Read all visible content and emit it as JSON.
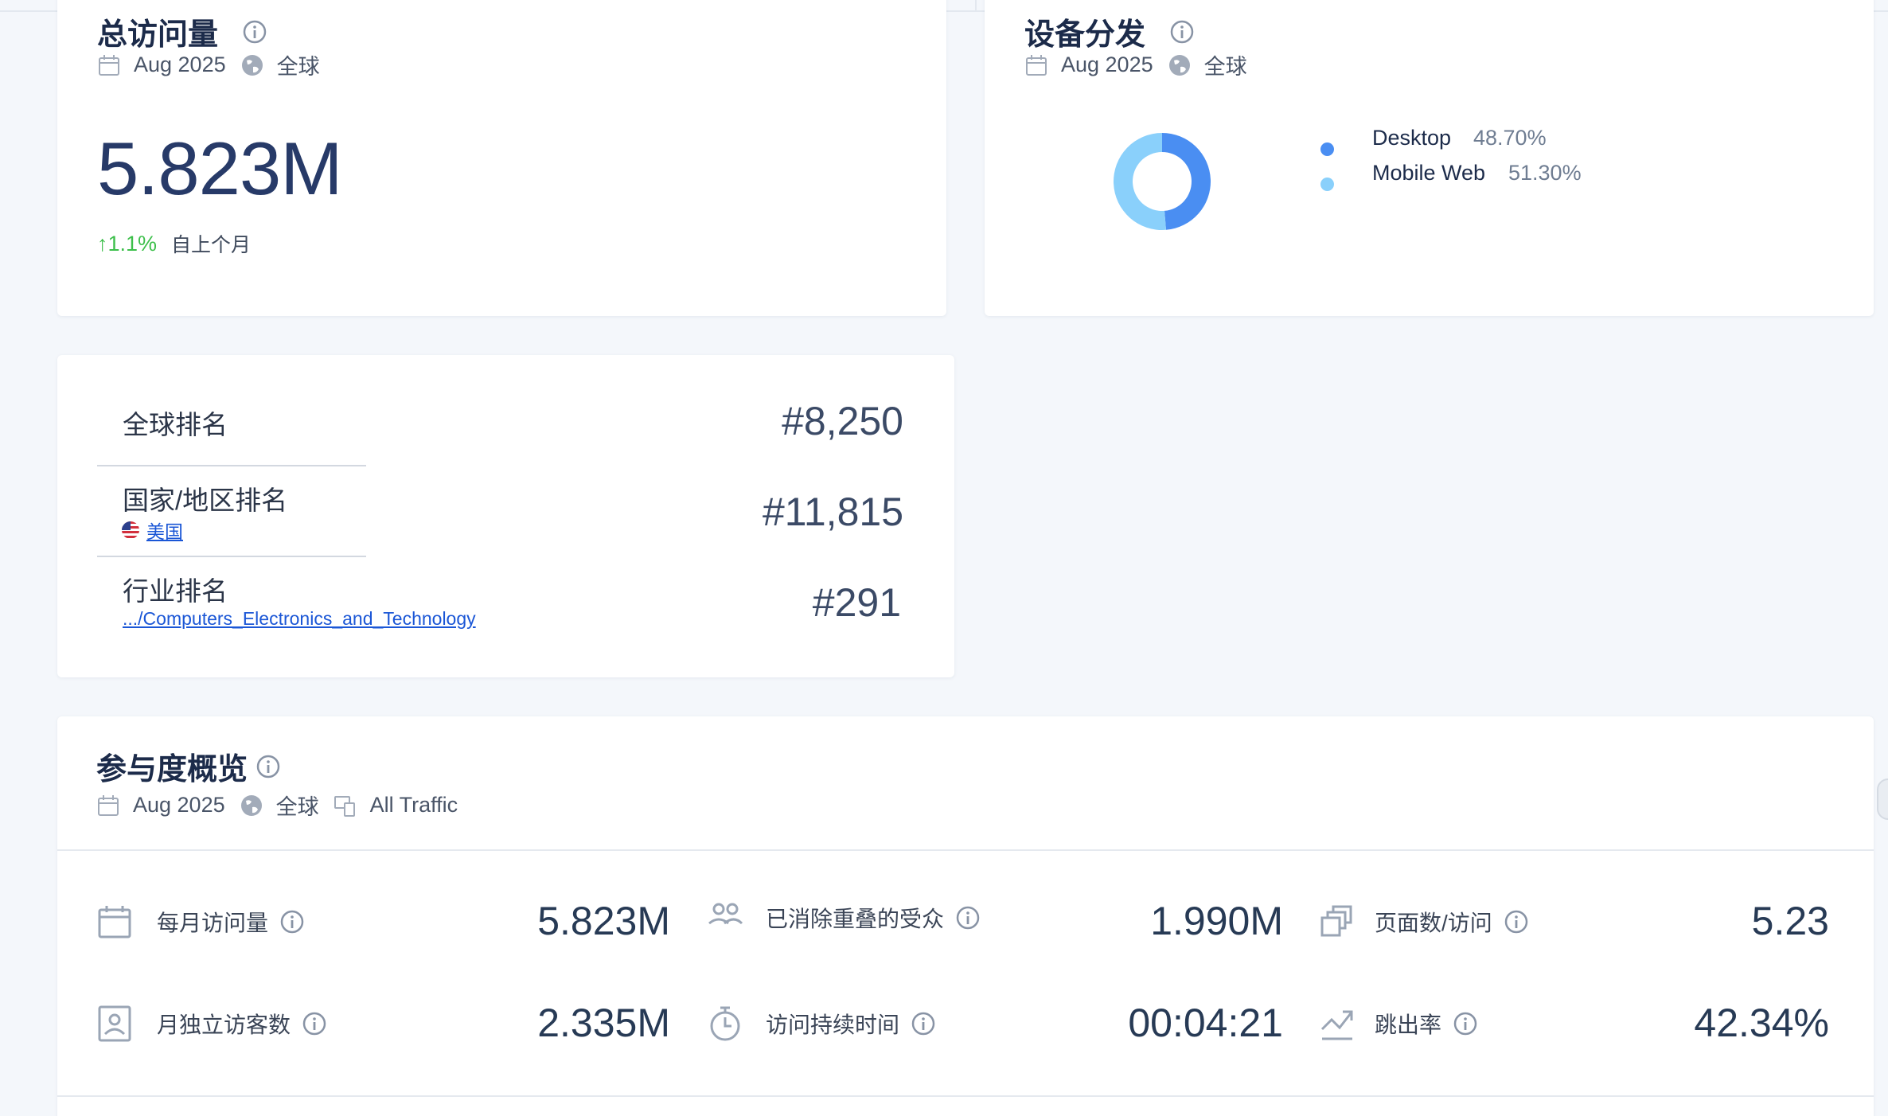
{
  "total_visits": {
    "title": "总访问量",
    "date": "Aug 2025",
    "region": "全球",
    "value": "5.823M",
    "change": "1.1%",
    "change_label": "自上个月"
  },
  "device": {
    "title": "设备分发",
    "date": "Aug 2025",
    "region": "全球",
    "items": [
      {
        "name": "Desktop",
        "value": "48.70%",
        "color": "#4a8ef2"
      },
      {
        "name": "Mobile Web",
        "value": "51.30%",
        "color": "#8ad0fb"
      }
    ],
    "shares": [
      48.7,
      51.3
    ]
  },
  "ranks": {
    "global": {
      "label": "全球排名",
      "value": "#8,250"
    },
    "country": {
      "label": "国家/地区排名",
      "sub": "美国",
      "value": "#11,815"
    },
    "category": {
      "label": "行业排名",
      "sub": ".../Computers_Electronics_and_Technology",
      "value": "#291"
    }
  },
  "engagement": {
    "title": "参与度概览",
    "date": "Aug 2025",
    "region": "全球",
    "traffic": "All Traffic",
    "metrics": {
      "monthly_visits": {
        "label": "每月访问量",
        "value": "5.823M",
        "icon": "calendar-icon"
      },
      "dedup_audience": {
        "label": "已消除重叠的受众",
        "value": "1.990M",
        "icon": "users-icon"
      },
      "pages_per_visit": {
        "label": "页面数/访问",
        "value": "5.23",
        "icon": "pages-icon"
      },
      "unique_visitors": {
        "label": "月独立访客数",
        "value": "2.335M",
        "icon": "visitor-card-icon"
      },
      "visit_duration": {
        "label": "访问持续时间",
        "value": "00:04:21",
        "icon": "stopwatch-icon"
      },
      "bounce_rate": {
        "label": "跳出率",
        "value": "42.34%",
        "icon": "bounce-arrow-icon"
      }
    }
  }
}
